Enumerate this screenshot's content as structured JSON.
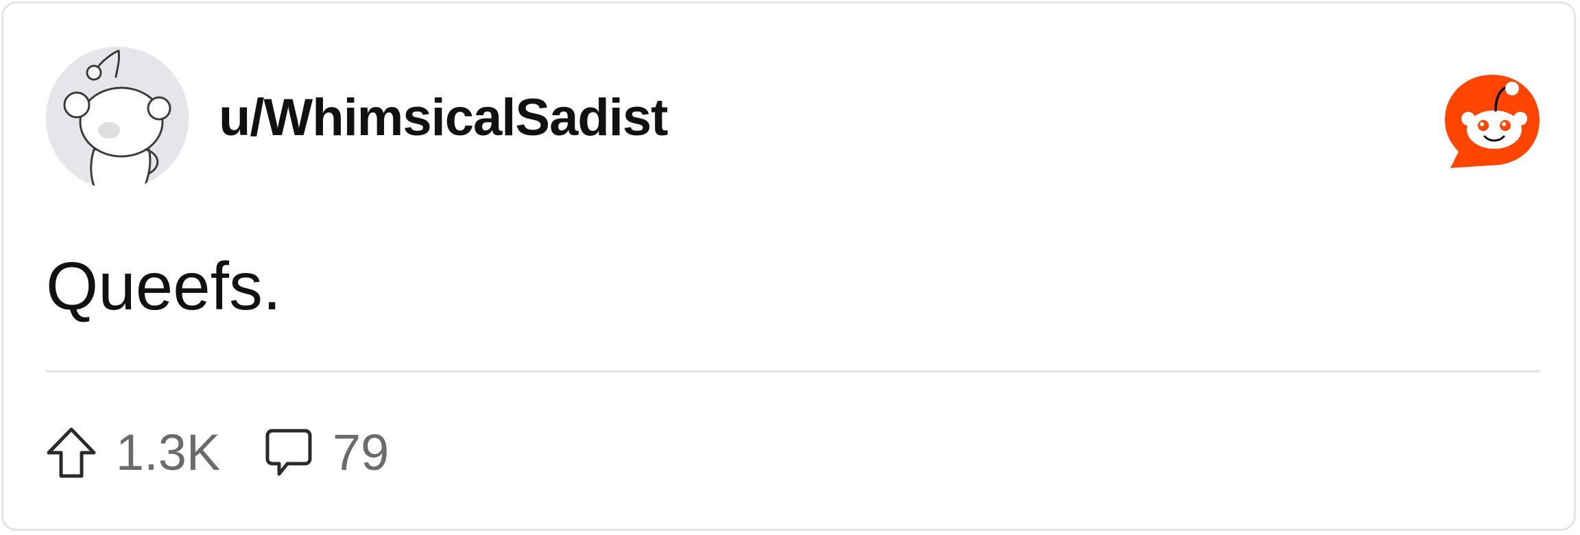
{
  "post": {
    "username": "u/WhimsicalSadist",
    "body": "Queefs.",
    "upvotes": "1.3K",
    "comments": "79"
  },
  "colors": {
    "brand": "#ff4500",
    "text": "#111111",
    "muted": "#6b6b6b",
    "avatar_bg": "#e6e6ea",
    "border": "#e4e4e4"
  },
  "icons": {
    "avatar": "snoo-avatar",
    "logo": "reddit-logo-icon",
    "upvote": "upvote-arrow-icon",
    "comment": "comment-bubble-icon"
  }
}
